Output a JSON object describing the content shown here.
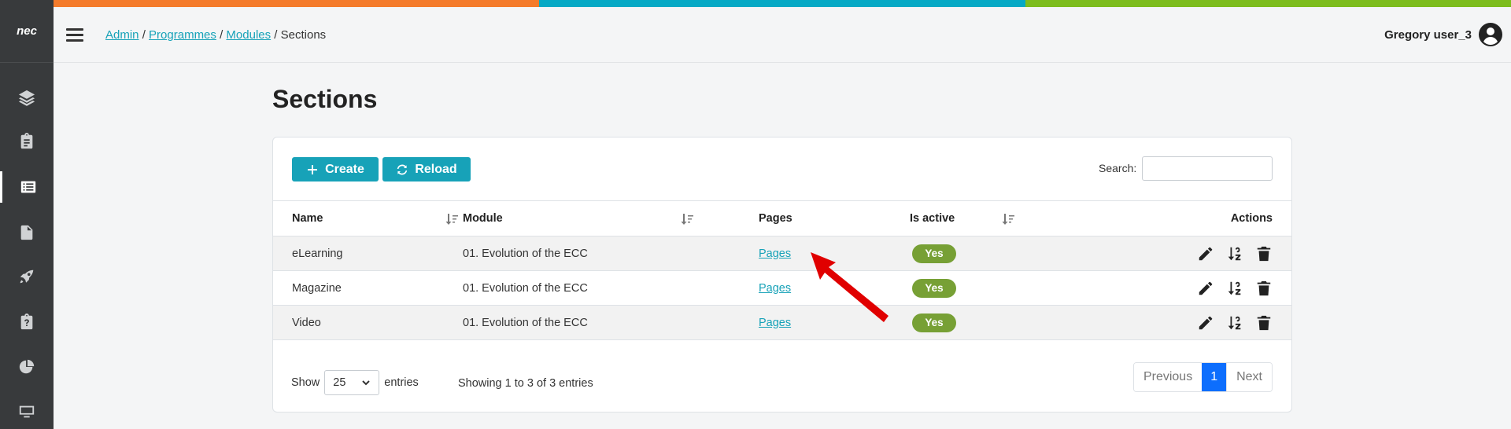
{
  "colors": {
    "topbar": [
      "#f47b2b",
      "#05a9c5",
      "#7dbd1d"
    ],
    "sidebar": "#383a3c",
    "accent": "#17a2b8",
    "badge": "#77a035",
    "annotation": "#e00000"
  },
  "logo": {
    "text": "nec"
  },
  "sidebar": {
    "items": [
      {
        "icon": "layers-icon"
      },
      {
        "icon": "clipboard-icon"
      },
      {
        "icon": "list-icon",
        "active": true
      },
      {
        "icon": "file-icon"
      },
      {
        "icon": "rocket-icon"
      },
      {
        "icon": "clipboard-question-icon"
      },
      {
        "icon": "pie-chart-icon"
      },
      {
        "icon": "desktop-icon"
      }
    ]
  },
  "breadcrumb": {
    "admin": "Admin",
    "programmes": "Programmes",
    "modules": "Modules",
    "current": "Sections",
    "sep": " / "
  },
  "user": {
    "name": "Gregory user_3"
  },
  "page": {
    "title": "Sections"
  },
  "toolbar": {
    "create_label": "Create",
    "reload_label": "Reload",
    "search_label": "Search:",
    "search_value": ""
  },
  "table": {
    "headers": {
      "name": "Name",
      "module": "Module",
      "pages": "Pages",
      "active": "Is active",
      "actions": "Actions"
    },
    "rows": [
      {
        "name": "eLearning",
        "module": "01. Evolution of the ECC",
        "pages": "Pages",
        "active": "Yes"
      },
      {
        "name": "Magazine",
        "module": "01. Evolution of the ECC",
        "pages": "Pages",
        "active": "Yes"
      },
      {
        "name": "Video",
        "module": "01. Evolution of the ECC",
        "pages": "Pages",
        "active": "Yes"
      }
    ]
  },
  "footer": {
    "show": "Show",
    "entries_value": "25",
    "entries": "entries",
    "info": "Showing 1 to 3 of 3 entries"
  },
  "pagination": {
    "previous": "Previous",
    "current": "1",
    "next": "Next"
  }
}
